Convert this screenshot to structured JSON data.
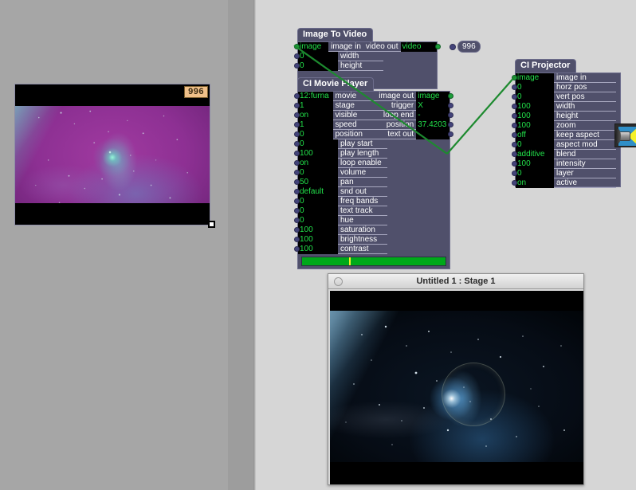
{
  "window": {
    "canvas_bg": "#d6d6d6",
    "panel_bg": "#a6a6a6"
  },
  "preview": {
    "badge": "996",
    "name": "image-preview"
  },
  "scrollbar": {
    "up_arrow": "scroll-up-arrow",
    "down_arrow": "scroll-down-arrow"
  },
  "nodes": [
    {
      "id": "image-to-video",
      "title": "Image To Video",
      "inputs": [
        {
          "value": "image",
          "label": "image in",
          "connected": true
        },
        {
          "value": "0",
          "label": "width",
          "connected": false
        },
        {
          "value": "0",
          "label": "height",
          "connected": false
        }
      ],
      "outputs": [
        {
          "label": "video out",
          "value": "video",
          "connected": true
        }
      ],
      "tag": "996"
    },
    {
      "id": "ci-movie-player",
      "title": "CI Movie Player",
      "inputs": [
        {
          "value": "12:furna",
          "label": "movie",
          "connected": false
        },
        {
          "value": "1",
          "label": "stage",
          "connected": false
        },
        {
          "value": "on",
          "label": "visible",
          "connected": false
        },
        {
          "value": "1",
          "label": "speed",
          "connected": false
        },
        {
          "value": "0",
          "label": "position",
          "connected": false
        },
        {
          "value": "0",
          "label": "play start",
          "connected": false
        },
        {
          "value": "100",
          "label": "play length",
          "connected": false
        },
        {
          "value": "on",
          "label": "loop enable",
          "connected": false
        },
        {
          "value": "0",
          "label": "volume",
          "connected": false
        },
        {
          "value": "50",
          "label": "pan",
          "connected": false
        },
        {
          "value": "default",
          "label": "snd out",
          "connected": false
        },
        {
          "value": "0",
          "label": "freq bands",
          "connected": false
        },
        {
          "value": "0",
          "label": "text track",
          "connected": false
        },
        {
          "value": "0",
          "label": "hue",
          "connected": false
        },
        {
          "value": "100",
          "label": "saturation",
          "connected": false
        },
        {
          "value": "100",
          "label": "brightness",
          "connected": false
        },
        {
          "value": "100",
          "label": "contrast",
          "connected": false
        }
      ],
      "outputs": [
        {
          "label": "image out",
          "value": "image",
          "connected": true
        },
        {
          "label": "trigger",
          "value": "X",
          "connected": false
        },
        {
          "label": "loop end",
          "value": "-",
          "connected": false
        },
        {
          "label": "position",
          "value": "37.4203",
          "connected": false
        },
        {
          "label": "text out",
          "value": "",
          "connected": false
        }
      ],
      "progress": {
        "percent": 33,
        "color": "#00a81a",
        "marker_color": "#f2ef28"
      }
    },
    {
      "id": "ci-projector",
      "title": "CI Projector",
      "inputs": [
        {
          "value": "image",
          "label": "image in",
          "connected": true
        },
        {
          "value": "0",
          "label": "horz pos",
          "connected": false
        },
        {
          "value": "0",
          "label": "vert pos",
          "connected": false
        },
        {
          "value": "100",
          "label": "width",
          "connected": false
        },
        {
          "value": "100",
          "label": "height",
          "connected": false
        },
        {
          "value": "100",
          "label": "zoom",
          "connected": false
        },
        {
          "value": "off",
          "label": "keep aspect",
          "connected": false
        },
        {
          "value": "0",
          "label": "aspect mod",
          "connected": false
        },
        {
          "value": "additive",
          "label": "blend",
          "connected": false
        },
        {
          "value": "100",
          "label": "intensity",
          "connected": false
        },
        {
          "value": "0",
          "label": "layer",
          "connected": false
        },
        {
          "value": "on",
          "label": "active",
          "connected": false
        }
      ],
      "outputs": [],
      "icon": "projector-icon"
    }
  ],
  "stage": {
    "title": "Untitled 1 : Stage 1",
    "close_label": "close"
  }
}
